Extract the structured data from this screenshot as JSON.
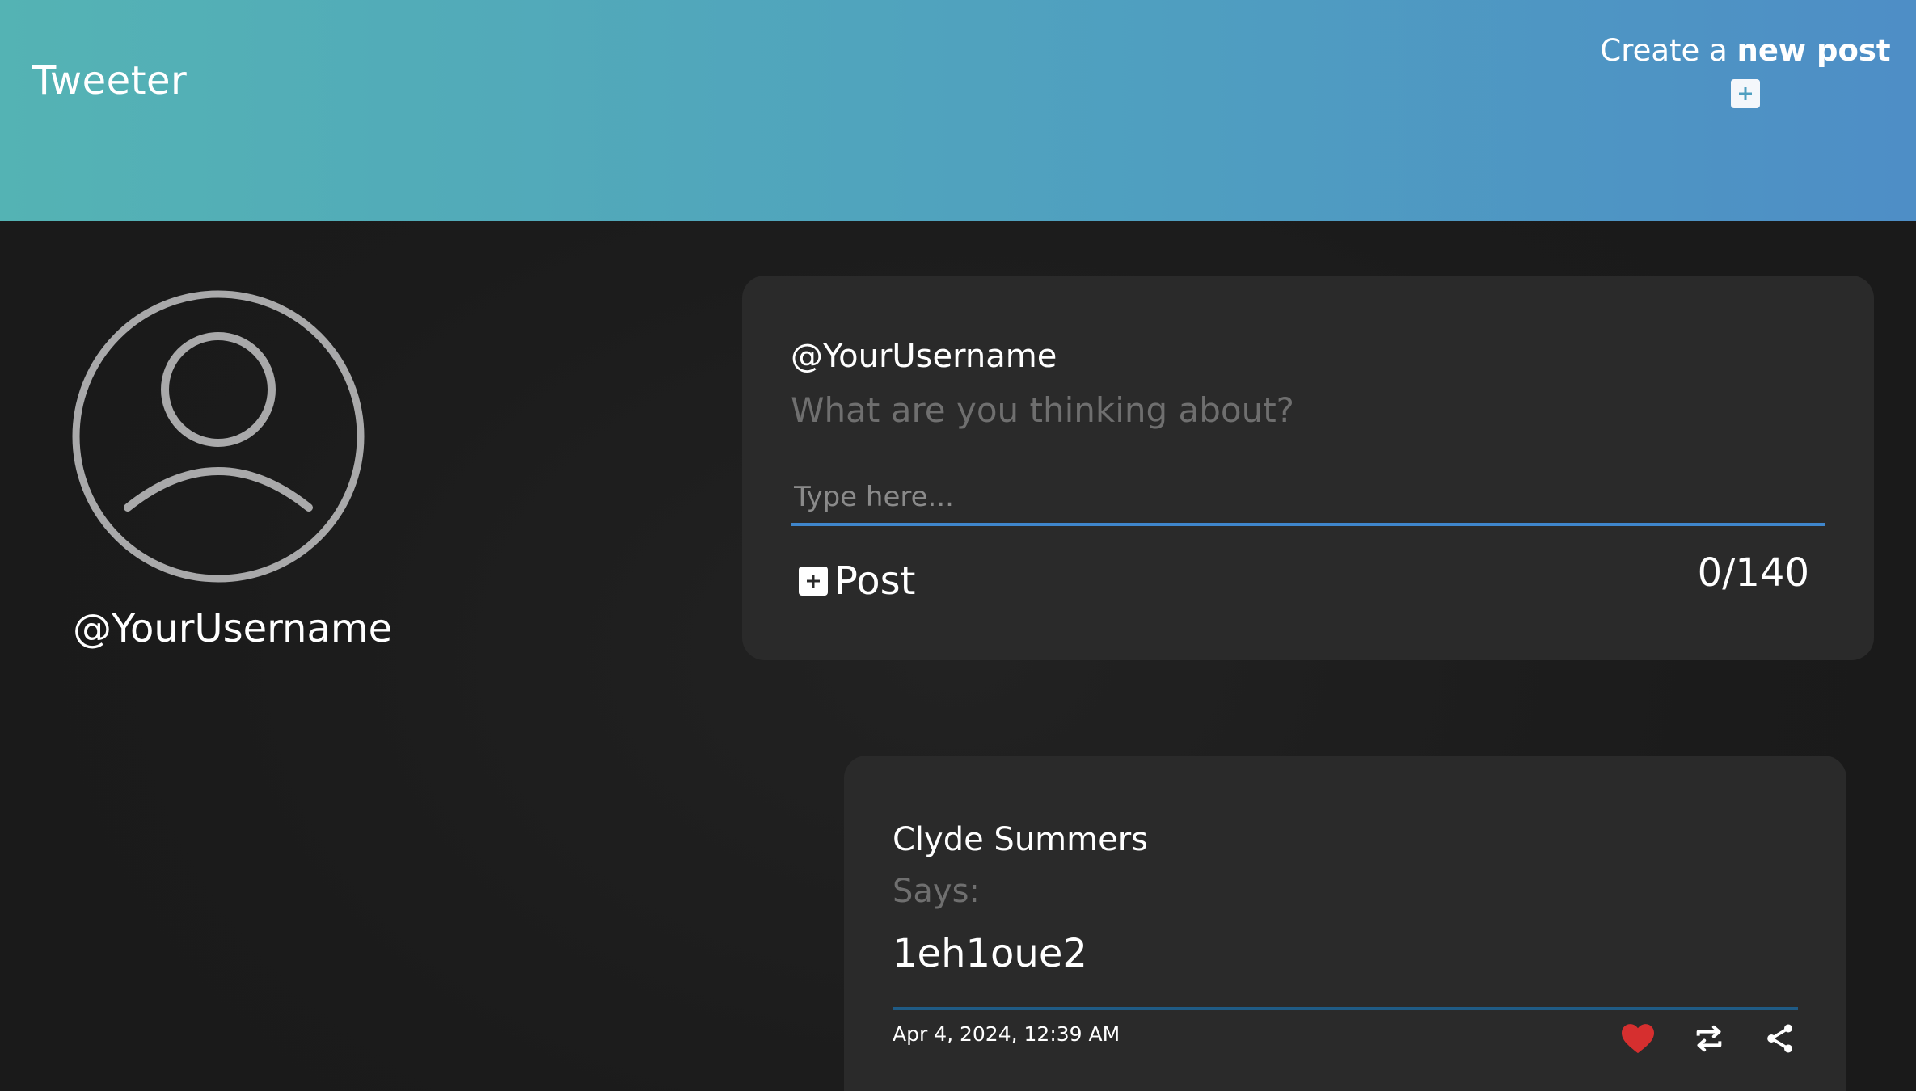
{
  "app": {
    "title": "Tweeter"
  },
  "header": {
    "create_post_prefix": "Create a ",
    "create_post_bold": "new post",
    "create_post_icon": "plus-square-icon"
  },
  "profile": {
    "avatar_icon": "user-circle-icon",
    "username": "@YourUsername"
  },
  "compose": {
    "username": "@YourUsername",
    "prompt": "What are you thinking about?",
    "input_value": "",
    "input_placeholder": "Type here...",
    "post_label": "Post",
    "post_icon": "plus-square-icon",
    "char_count": "0/140"
  },
  "feed": {
    "tweets": [
      {
        "author": "Clyde Summers",
        "says_label": "Says:",
        "content": "1eh1oue2",
        "timestamp": "Apr 4, 2024, 12:39 AM",
        "actions": [
          {
            "icon": "heart-icon",
            "color": "#d62f2f"
          },
          {
            "icon": "retweet-icon",
            "color": "#ffffff"
          },
          {
            "icon": "share-icon",
            "color": "#ffffff"
          }
        ]
      }
    ]
  },
  "colors": {
    "header_gradient_start": "#54b3b4",
    "header_gradient_end": "#4e8ec6",
    "background": "#1b1b1b",
    "card": "#2a2a2a",
    "input_underline": "#3f86cc",
    "like_active": "#d62f2f"
  }
}
